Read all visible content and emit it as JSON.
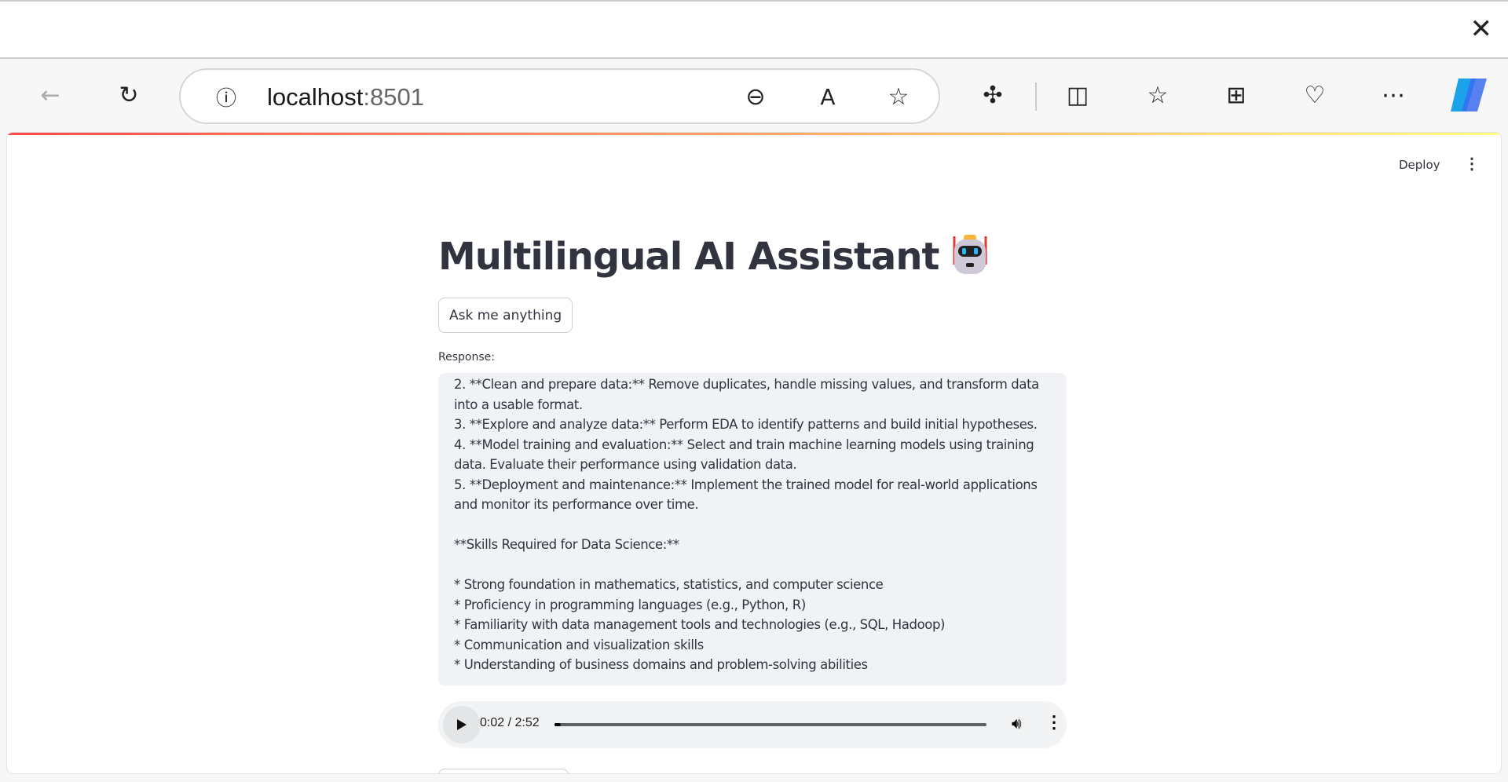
{
  "browser": {
    "url_host": "localhost",
    "url_port": ":8501",
    "icons": [
      "back-icon",
      "refresh-icon",
      "info-icon",
      "zoom-out-icon",
      "read-aloud-icon",
      "favorite-star-icon",
      "extensions-icon",
      "split-screen-icon",
      "favorites-icon",
      "collections-icon",
      "browser-health-icon",
      "more-icon",
      "copilot-icon",
      "close-icon"
    ]
  },
  "app": {
    "deploy_label": "Deploy",
    "title": "Multilingual AI Assistant",
    "title_emoji": "robot",
    "ask_button": "Ask me anything",
    "response_label": "Response:",
    "response_text": "2. **Clean and prepare data:** Remove duplicates, handle missing values, and transform data into a usable format.\n3. **Explore and analyze data:** Perform EDA to identify patterns and build initial hypotheses.\n4. **Model training and evaluation:** Select and train machine learning models using training data. Evaluate their performance using validation data.\n5. **Deployment and maintenance:** Implement the trained model for real-world applications and monitor its performance over time.\n\n**Skills Required for Data Science:**\n\n* Strong foundation in mathematics, statistics, and computer science\n* Proficiency in programming languages (e.g., Python, R)\n* Familiarity with data management tools and technologies (e.g., SQL, Hadoop)\n* Communication and visualization skills\n* Understanding of business domains and problem-solving abilities"
  },
  "audio": {
    "time": "0:02 / 2:52",
    "progress_fraction": 0.012
  }
}
